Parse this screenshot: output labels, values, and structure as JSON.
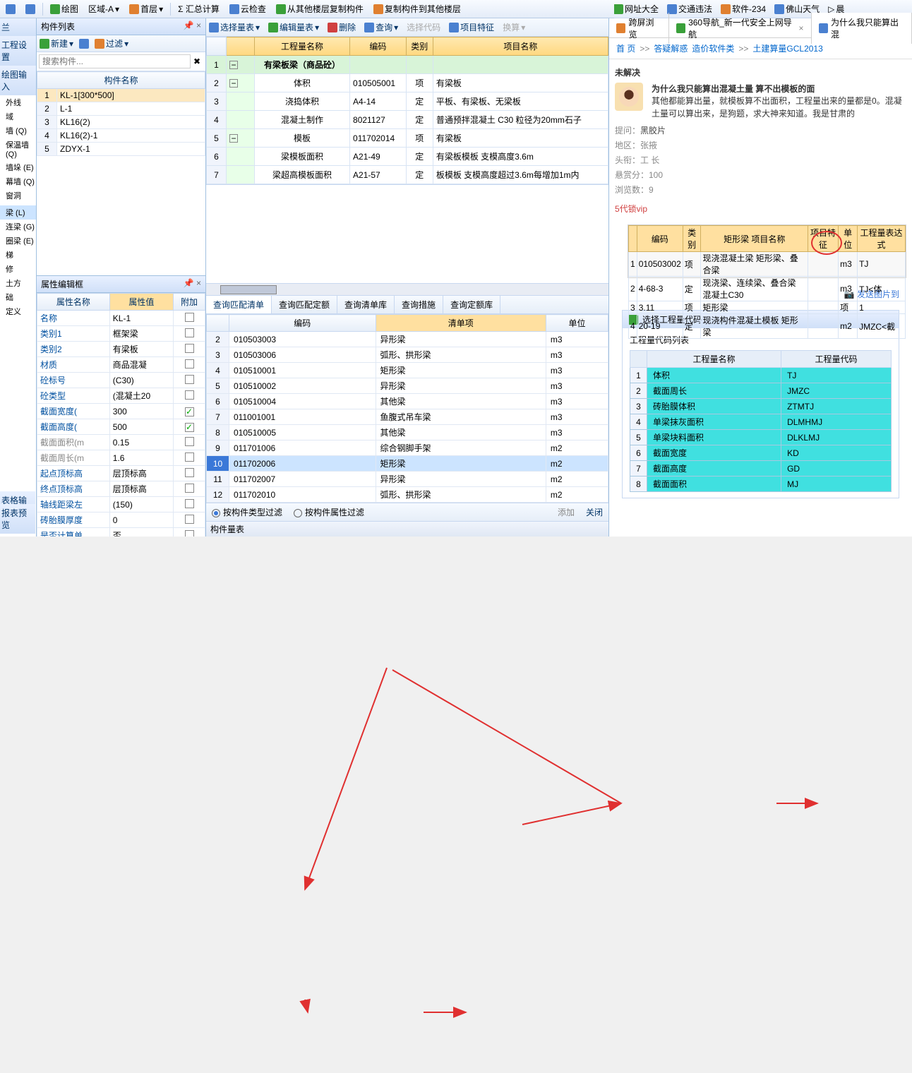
{
  "topbar": {
    "draw": "绘图",
    "zone": "区域-A",
    "floor": "首层",
    "sigma": "Σ 汇总计算",
    "cloud": "云检查",
    "copy_from": "从其他楼层复制构件",
    "copy_to": "复制构件到其他楼层"
  },
  "left_tree": {
    "title1": "兰",
    "title2": "工程设置",
    "title3": "绘图输入",
    "items": [
      "外线",
      "域",
      "墙 (Q)",
      "保温墙 (Q)",
      "墙垛 (E)",
      "幕墙 (Q)",
      "窗洞",
      "",
      "梁 (L)",
      "连梁 (G)",
      "圈梁 (E)",
      "梯",
      "修",
      "土方",
      "础",
      "定义"
    ],
    "bottom1": "表格输入",
    "bottom2": "报表预览"
  },
  "comp_panel": {
    "title": "构件列表",
    "new": "新建",
    "filter": "过滤",
    "search_ph": "搜索构件...",
    "col": "构件名称",
    "rows": [
      "KL-1[300*500]",
      "L-1",
      "KL16(2)",
      "KL16(2)-1",
      "ZDYX-1"
    ]
  },
  "prop_panel": {
    "title": "属性编辑框",
    "cols": [
      "属性名称",
      "属性值",
      "附加"
    ],
    "rows": [
      {
        "k": "名称",
        "v": "KL-1",
        "c": false,
        "g": false
      },
      {
        "k": "类别1",
        "v": "框架梁",
        "c": false,
        "g": false
      },
      {
        "k": "类别2",
        "v": "有梁板",
        "c": false,
        "g": false
      },
      {
        "k": "材质",
        "v": "商品混凝",
        "c": false,
        "g": false
      },
      {
        "k": "砼标号",
        "v": "(C30)",
        "c": false,
        "g": false
      },
      {
        "k": "砼类型",
        "v": "(混凝土20",
        "c": false,
        "g": false
      },
      {
        "k": "截面宽度(",
        "v": "300",
        "c": true,
        "g": false
      },
      {
        "k": "截面高度(",
        "v": "500",
        "c": true,
        "g": false
      },
      {
        "k": "截面面积(m",
        "v": "0.15",
        "c": false,
        "g": true
      },
      {
        "k": "截面周长(m",
        "v": "1.6",
        "c": false,
        "g": true
      },
      {
        "k": "起点顶标高",
        "v": "层顶标高",
        "c": false,
        "g": false
      },
      {
        "k": "终点顶标高",
        "v": "层顶标高",
        "c": false,
        "g": false
      },
      {
        "k": "轴线距梁左",
        "v": "(150)",
        "c": false,
        "g": false
      },
      {
        "k": "砖胎膜厚度",
        "v": "0",
        "c": false,
        "g": false
      },
      {
        "k": "是否计算单",
        "v": "否",
        "c": false,
        "g": false
      }
    ]
  },
  "center_tb": {
    "select_qty": "选择量表",
    "edit_qty": "编辑量表",
    "delete": "删除",
    "query": "查询",
    "sel_code": "选择代码",
    "proj_feat": "项目特征",
    "convert": "换算"
  },
  "qty_grid": {
    "cols": [
      "",
      "工程量名称",
      "编码",
      "类别",
      "项目名称"
    ],
    "group": "有梁板梁（商品砼）",
    "rows": [
      {
        "n": "2",
        "name": "体积",
        "code": "010505001",
        "cat": "项",
        "proj": "有梁板"
      },
      {
        "n": "3",
        "name": "浇捣体积",
        "code": "A4-14",
        "cat": "定",
        "proj": "平板、有梁板、无梁板"
      },
      {
        "n": "4",
        "name": "混凝土制作",
        "code": "8021127",
        "cat": "定",
        "proj": "普通预拌混凝土 C30 粒径为20mm石子"
      },
      {
        "n": "5",
        "name": "模板",
        "code": "011702014",
        "cat": "项",
        "proj": "有梁板"
      },
      {
        "n": "6",
        "name": "梁模板面积",
        "code": "A21-49",
        "cat": "定",
        "proj": "有梁板模板 支模高度3.6m"
      },
      {
        "n": "7",
        "name": "梁超高模板面积",
        "code": "A21-57",
        "cat": "定",
        "proj": "板模板 支模高度超过3.6m每增加1m内"
      }
    ]
  },
  "lower_tabs": [
    "查询匹配清单",
    "查询匹配定额",
    "查询清单库",
    "查询措施",
    "查询定额库"
  ],
  "lower_grid": {
    "cols": [
      "",
      "编码",
      "清单项",
      "单位"
    ],
    "rows": [
      {
        "n": "2",
        "code": "010503003",
        "item": "异形梁",
        "u": "m3"
      },
      {
        "n": "3",
        "code": "010503006",
        "item": "弧形、拱形梁",
        "u": "m3"
      },
      {
        "n": "4",
        "code": "010510001",
        "item": "矩形梁",
        "u": "m3"
      },
      {
        "n": "5",
        "code": "010510002",
        "item": "异形梁",
        "u": "m3"
      },
      {
        "n": "6",
        "code": "010510004",
        "item": "其他梁",
        "u": "m3"
      },
      {
        "n": "7",
        "code": "011001001",
        "item": "鱼腹式吊车梁",
        "u": "m3"
      },
      {
        "n": "8",
        "code": "010510005",
        "item": "其他梁",
        "u": "m3"
      },
      {
        "n": "9",
        "code": "011701006",
        "item": "综合钢脚手架",
        "u": "m2"
      },
      {
        "n": "10",
        "code": "011702006",
        "item": "矩形梁",
        "u": "m2"
      },
      {
        "n": "11",
        "code": "011702007",
        "item": "异形梁",
        "u": "m2"
      },
      {
        "n": "12",
        "code": "011702010",
        "item": "弧形、拱形梁",
        "u": "m2"
      }
    ]
  },
  "filter_bar": {
    "by_type": "按构件类型过滤",
    "by_prop": "按构件属性过滤",
    "add": "添加",
    "close": "关闭"
  },
  "status_tab": "构件量表",
  "browser": {
    "top": [
      "网址大全",
      "交通违法",
      "软件-234",
      "佛山天气",
      "晨"
    ],
    "tabbar": {
      "cross": "跨屏浏览",
      "tab1": "360导航_新一代安全上网导航",
      "tab2": "为什么我只能算出混"
    },
    "crumb": [
      "首 页",
      "答疑解惑",
      "造价软件类",
      "土建算量GCL2013"
    ],
    "status": "未解决",
    "title": "为什么我只能算出混凝土量 算不出模板的面",
    "desc": "其他都能算出量，就模板算不出面积，工程量出来的量都是0。混凝土量可以算出来，是狗题，求大神来知道。我是甘肃的",
    "meta": {
      "ask": "提问：",
      "asker": "黑胶片",
      "region": "地区：张掖",
      "title": "头衔：工 长",
      "reward": "悬赏分：100",
      "views": "浏览数：9"
    },
    "vip": "5代锁vip",
    "emb_cols": [
      "",
      "编码",
      "类别",
      "矩形梁 项目名称",
      "项目特征",
      "单位",
      "工程量表达式"
    ],
    "emb_rows": [
      {
        "n": "1",
        "code": "010503002",
        "cat": "项",
        "name": "现浇混凝土梁 矩形梁、叠合梁",
        "feat": "",
        "u": "m3",
        "expr": "TJ"
      },
      {
        "n": "2",
        "code": "4-68-3",
        "cat": "定",
        "name": "现浇梁、连续梁、叠合梁 混凝土C30",
        "feat": "",
        "u": "m3",
        "expr": "TJ<体"
      },
      {
        "n": "3",
        "code": "3.11",
        "cat": "项",
        "name": "矩形梁",
        "feat": "",
        "u": "项",
        "expr": "1"
      },
      {
        "n": "4",
        "code": "20-19",
        "cat": "定",
        "name": "现浇构件混凝土模板 矩形梁",
        "feat": "",
        "u": "m2",
        "expr": "JMZC<截"
      }
    ],
    "send_pic": "发送图片到",
    "dlg_title": "选择工程量代码",
    "dlg_sub": "工程量代码列表",
    "code_cols": [
      "",
      "工程量名称",
      "工程量代码"
    ],
    "code_rows": [
      {
        "n": "1",
        "name": "体积",
        "code": "TJ"
      },
      {
        "n": "2",
        "name": "截面周长",
        "code": "JMZC"
      },
      {
        "n": "3",
        "name": "砖胎膜体积",
        "code": "ZTMTJ"
      },
      {
        "n": "4",
        "name": "单梁抹灰面积",
        "code": "DLMHMJ"
      },
      {
        "n": "5",
        "name": "单梁块料面积",
        "code": "DLKLMJ"
      },
      {
        "n": "6",
        "name": "截面宽度",
        "code": "KD"
      },
      {
        "n": "7",
        "name": "截面高度",
        "code": "GD"
      },
      {
        "n": "8",
        "name": "截面面积",
        "code": "MJ"
      }
    ]
  }
}
